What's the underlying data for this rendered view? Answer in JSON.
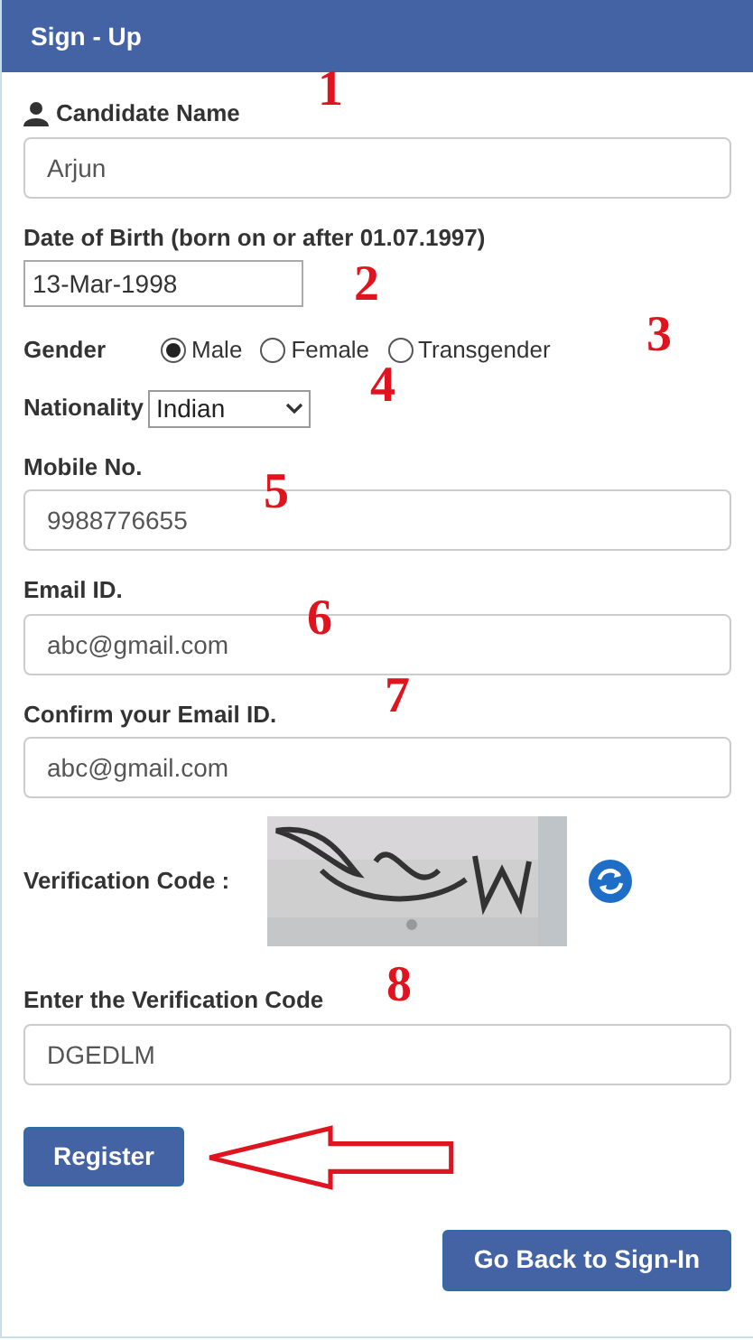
{
  "header": {
    "title": "Sign - Up"
  },
  "fields": [
    {
      "kind": "name",
      "label": "Candidate Name",
      "value": "Arjun",
      "annotation": "1"
    },
    {
      "kind": "date",
      "label": "Date of Birth (born on or after 01.07.1997)",
      "value": "13-Mar-1998",
      "annotation": "2"
    },
    {
      "kind": "radio",
      "label": "Gender",
      "annotation": "3",
      "options": [
        {
          "label": "Male",
          "selected": true
        },
        {
          "label": "Female",
          "selected": false
        },
        {
          "label": "Transgender",
          "selected": false
        }
      ]
    },
    {
      "kind": "select",
      "label": "Nationality",
      "value": "Indian",
      "annotation": "4"
    },
    {
      "kind": "text",
      "label": "Mobile No.",
      "value": "9988776655",
      "annotation": "5"
    },
    {
      "kind": "text",
      "label": "Email ID.",
      "value": "abc@gmail.com",
      "annotation": "6"
    },
    {
      "kind": "text",
      "label": "Confirm your Email ID.",
      "value": "abc@gmail.com",
      "annotation": "7"
    },
    {
      "kind": "captcha",
      "label": "Verification Code :"
    },
    {
      "kind": "text",
      "label": "Enter the Verification Code",
      "value": "DGEDLM",
      "annotation": "8"
    }
  ],
  "register_button": {
    "label": "Register"
  },
  "back_button": {
    "label": "Go Back to Sign-In"
  }
}
